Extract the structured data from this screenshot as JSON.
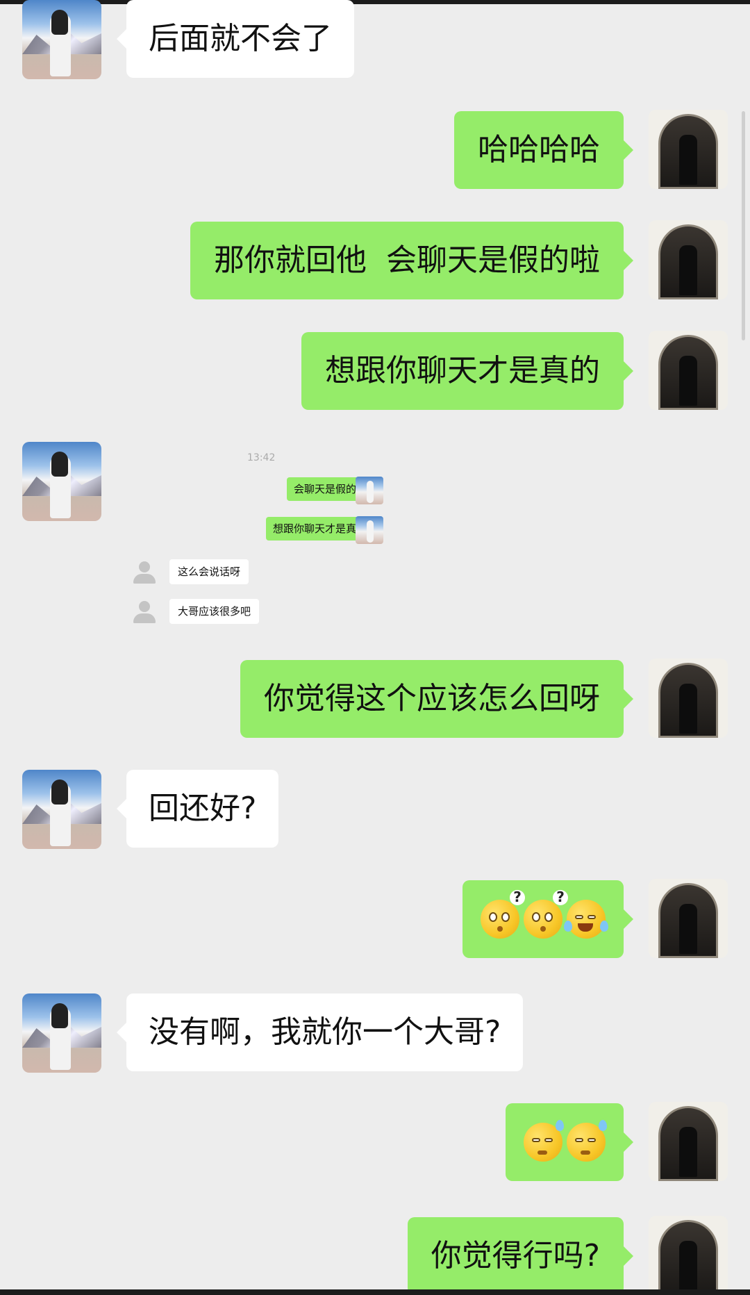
{
  "conversation": {
    "messages": [
      {
        "sender": "her",
        "text": "后面就不会了"
      },
      {
        "sender": "me",
        "text": "哈哈哈哈"
      },
      {
        "sender": "me",
        "text": "那你就回他  会聊天是假的啦"
      },
      {
        "sender": "me",
        "text": "想跟你聊天才是真的"
      },
      {
        "sender": "her",
        "type": "screenshot"
      },
      {
        "sender": "me",
        "text": "你觉得这个应该怎么回呀"
      },
      {
        "sender": "her",
        "text": "回还好?"
      },
      {
        "sender": "me",
        "type": "emoji",
        "emojis": [
          "confused-face-emoji",
          "confused-face-emoji",
          "laughing-tears-emoji"
        ]
      },
      {
        "sender": "her",
        "text": "没有啊，我就你一个大哥?"
      },
      {
        "sender": "me",
        "type": "emoji",
        "emojis": [
          "sweat-face-emoji",
          "sweat-face-emoji"
        ]
      },
      {
        "sender": "me",
        "text": "你觉得行吗?"
      }
    ]
  },
  "screenshot": {
    "time": "13:42",
    "messages": [
      {
        "sender": "me",
        "text": "会聊天是假的啦"
      },
      {
        "sender": "me",
        "text": "想跟你聊天才是真的"
      },
      {
        "sender": "other",
        "text": "这么会说话呀"
      },
      {
        "sender": "other",
        "text": "大哥应该很多吧"
      }
    ]
  },
  "colors": {
    "background": "#ededed",
    "sent_bubble": "#95ec69",
    "received_bubble": "#ffffff"
  }
}
